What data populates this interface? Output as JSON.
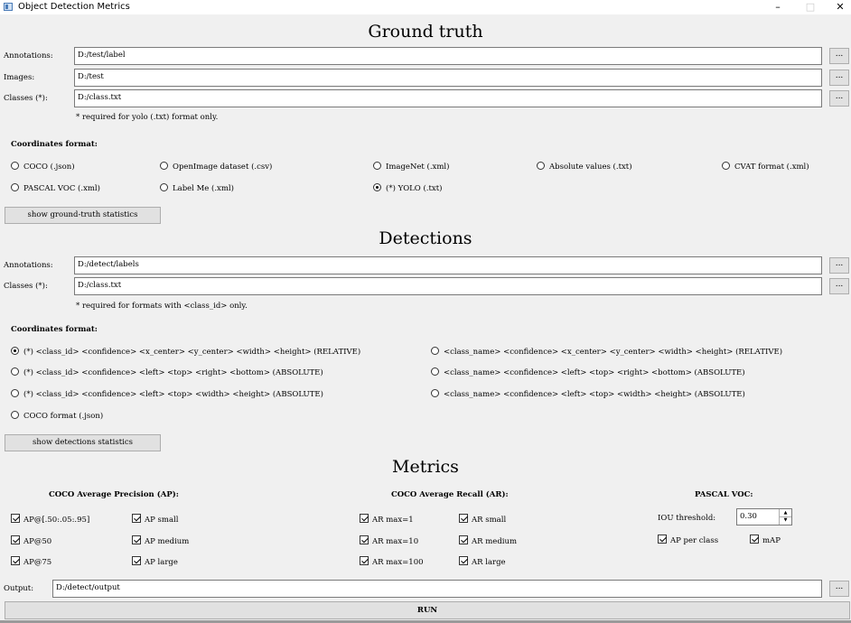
{
  "window": {
    "title": "Object Detection Metrics",
    "minimize": "–",
    "maximize": "□",
    "close": "✕"
  },
  "ground_truth": {
    "title": "Ground truth",
    "annotations_label": "Annotations:",
    "annotations_value": "D:/test/label",
    "images_label": "Images:",
    "images_value": "D:/test",
    "classes_label": "Classes (*):",
    "classes_value": "D:/class.txt",
    "note": "* required for yolo (.txt) format only.",
    "coords_label": "Coordinates format:",
    "formats": [
      "COCO (.json)",
      "OpenImage dataset (.csv)",
      "ImageNet (.xml)",
      "Absolute values (.txt)",
      "CVAT format (.xml)",
      "PASCAL VOC (.xml)",
      "Label Me (.xml)",
      "(*) YOLO (.txt)"
    ],
    "selected_format": "(*) YOLO (.txt)",
    "stats_button": "show ground-truth statistics"
  },
  "detections": {
    "title": "Detections",
    "annotations_label": "Annotations:",
    "annotations_value": "D:/detect/labels",
    "classes_label": "Classes (*):",
    "classes_value": "D:/class.txt",
    "note": "* required for formats with <class_id> only.",
    "coords_label": "Coordinates format:",
    "formats": [
      "(*) <class_id> <confidence> <x_center> <y_center> <width> <height> (RELATIVE)",
      "(*) <class_id> <confidence> <left> <top> <right> <bottom> (ABSOLUTE)",
      "(*) <class_id> <confidence> <left> <top> <width> <height> (ABSOLUTE)",
      "COCO format (.json)",
      "<class_name> <confidence> <x_center> <y_center> <width> <height> (RELATIVE)",
      "<class_name> <confidence> <left> <top> <right> <bottom> (ABSOLUTE)",
      "<class_name> <confidence> <left> <top> <width> <height> (ABSOLUTE)"
    ],
    "selected_format": "(*) <class_id> <confidence> <x_center> <y_center> <width> <height> (RELATIVE)",
    "stats_button": "show detections statistics"
  },
  "metrics": {
    "title": "Metrics",
    "coco_ap_label": "COCO Average Precision (AP):",
    "coco_ap": [
      {
        "label": "AP@[.50:.05:.95]",
        "checked": true
      },
      {
        "label": "AP@50",
        "checked": true
      },
      {
        "label": "AP@75",
        "checked": true
      },
      {
        "label": "AP small",
        "checked": true
      },
      {
        "label": "AP medium",
        "checked": true
      },
      {
        "label": "AP large",
        "checked": true
      }
    ],
    "coco_ar_label": "COCO Average Recall (AR):",
    "coco_ar": [
      {
        "label": "AR max=1",
        "checked": true
      },
      {
        "label": "AR max=10",
        "checked": true
      },
      {
        "label": "AR max=100",
        "checked": true
      },
      {
        "label": "AR small",
        "checked": true
      },
      {
        "label": "AR medium",
        "checked": true
      },
      {
        "label": "AR large",
        "checked": true
      }
    ],
    "pascal_label": "PASCAL VOC:",
    "iou_label": "IOU threshold:",
    "iou_value": "0.30",
    "ap_per_class": {
      "label": "AP per class",
      "checked": true
    },
    "map": {
      "label": "mAP",
      "checked": true
    }
  },
  "output": {
    "label": "Output:",
    "value": "D:/detect/output"
  },
  "browse_label": "...",
  "run_button": "RUN",
  "icons": {
    "spin_up": "▲",
    "spin_down": "▼"
  }
}
